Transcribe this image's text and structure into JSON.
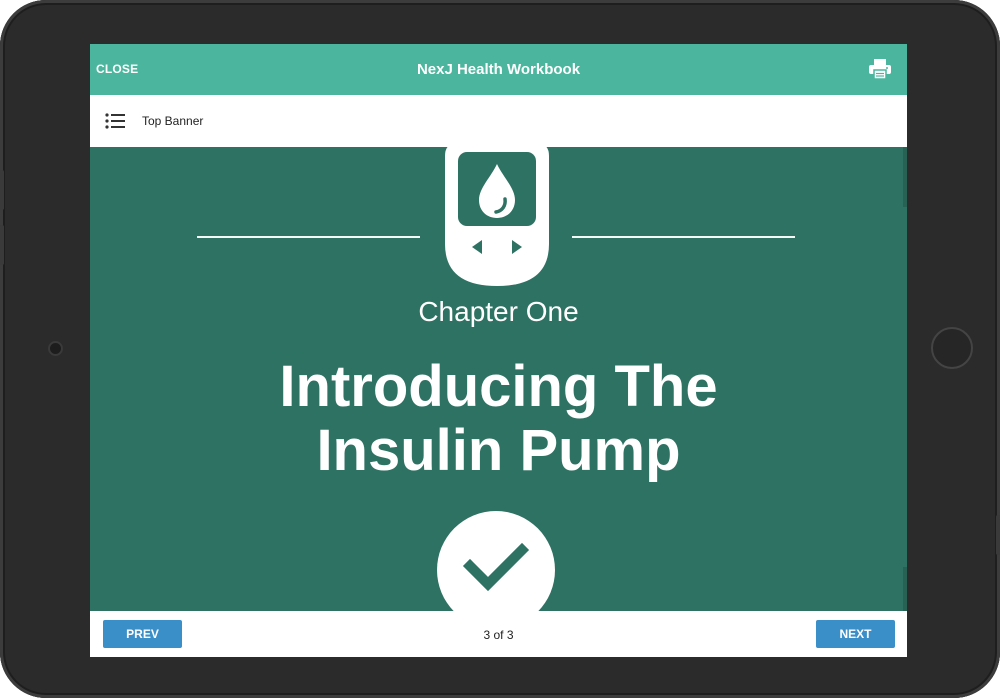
{
  "header": {
    "close_label": "CLOSE",
    "title": "NexJ Health Workbook",
    "print_icon": "printer-icon"
  },
  "banner": {
    "menu_icon": "list-menu-icon",
    "label": "Top Banner"
  },
  "content": {
    "chapter_label": "Chapter One",
    "title_line1": "Introducing The",
    "title_line2": "Insulin Pump",
    "top_icon": "glucose-meter-icon",
    "bottom_icon": "checkmark-icon"
  },
  "footer": {
    "prev_label": "PREV",
    "page_count": "3 of 3",
    "next_label": "NEXT"
  },
  "colors": {
    "header_bg": "#4bb69d",
    "content_bg": "#2e7263",
    "button_bg": "#3a8fc8",
    "device_frame": "#2b2b2b"
  }
}
